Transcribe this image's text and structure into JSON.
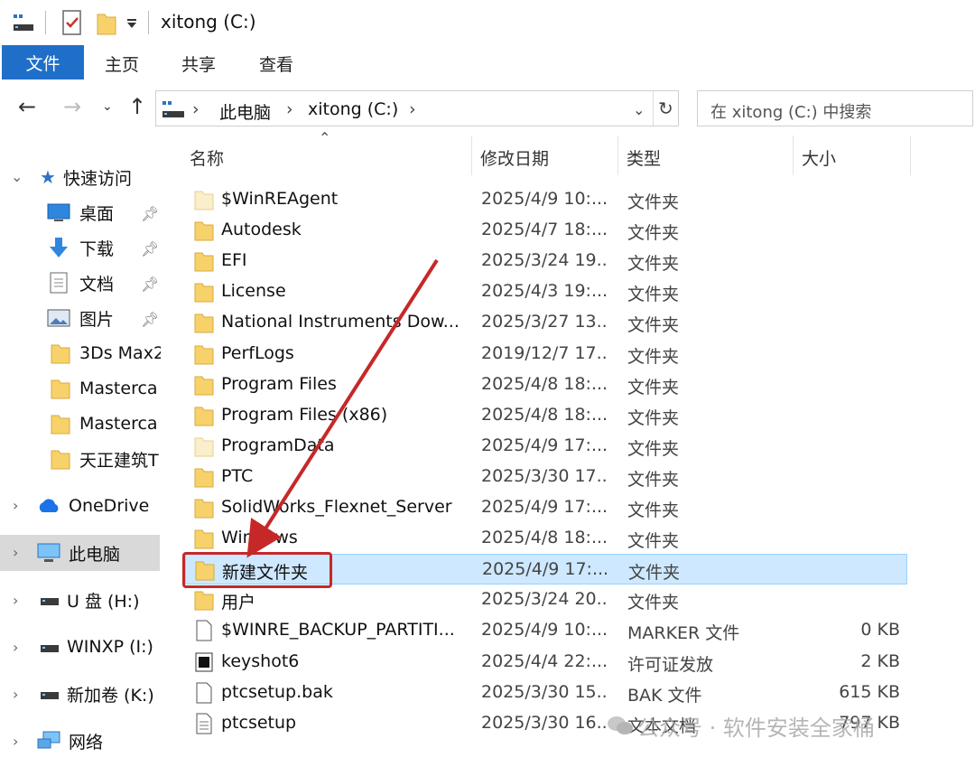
{
  "window": {
    "title": "xitong (C:)"
  },
  "ribbon": {
    "tabs": [
      "文件",
      "主页",
      "共享",
      "查看"
    ]
  },
  "address": {
    "parts": [
      "此电脑",
      "xitong (C:)"
    ]
  },
  "search": {
    "placeholder": "在 xitong (C:) 中搜索"
  },
  "nav": {
    "quick_access": "快速访问",
    "pinned": [
      {
        "label": "桌面",
        "icon": "desktop-icon"
      },
      {
        "label": "下载",
        "icon": "download-icon"
      },
      {
        "label": "文档",
        "icon": "document-icon"
      },
      {
        "label": "图片",
        "icon": "picture-icon"
      }
    ],
    "recent": [
      "3Ds Max2",
      "Masterca",
      "Masterca",
      "天正建筑T"
    ],
    "onedrive": "OneDrive",
    "this_pc": "此电脑",
    "drives": [
      "U 盘 (H:)",
      "WINXP (I:)",
      "新加卷 (K:)"
    ],
    "network": "网络"
  },
  "columns": {
    "name": "名称",
    "date": "修改日期",
    "type": "类型",
    "size": "大小"
  },
  "files": [
    {
      "name": "$WinREAgent",
      "date": "2025/4/9 10:...",
      "type": "文件夹",
      "size": "",
      "icon": "folder-light-icon"
    },
    {
      "name": "Autodesk",
      "date": "2025/4/7 18:...",
      "type": "文件夹",
      "size": "",
      "icon": "folder-icon"
    },
    {
      "name": "EFI",
      "date": "2025/3/24 19...",
      "type": "文件夹",
      "size": "",
      "icon": "folder-icon"
    },
    {
      "name": "License",
      "date": "2025/4/3 19:...",
      "type": "文件夹",
      "size": "",
      "icon": "folder-icon"
    },
    {
      "name": "National Instruments Dow...",
      "date": "2025/3/27 13...",
      "type": "文件夹",
      "size": "",
      "icon": "folder-icon"
    },
    {
      "name": "PerfLogs",
      "date": "2019/12/7 17...",
      "type": "文件夹",
      "size": "",
      "icon": "folder-icon"
    },
    {
      "name": "Program Files",
      "date": "2025/4/8 18:...",
      "type": "文件夹",
      "size": "",
      "icon": "folder-icon"
    },
    {
      "name": "Program Files (x86)",
      "date": "2025/4/8 18:...",
      "type": "文件夹",
      "size": "",
      "icon": "folder-icon"
    },
    {
      "name": "ProgramData",
      "date": "2025/4/9 17:...",
      "type": "文件夹",
      "size": "",
      "icon": "folder-light-icon"
    },
    {
      "name": "PTC",
      "date": "2025/3/30 17...",
      "type": "文件夹",
      "size": "",
      "icon": "folder-icon"
    },
    {
      "name": "SolidWorks_Flexnet_Server",
      "date": "2025/4/9 17:...",
      "type": "文件夹",
      "size": "",
      "icon": "folder-icon"
    },
    {
      "name": "Windows",
      "date": "2025/4/8 18:...",
      "type": "文件夹",
      "size": "",
      "icon": "folder-icon"
    },
    {
      "name": "新建文件夹",
      "date": "2025/4/9 17:...",
      "type": "文件夹",
      "size": "",
      "icon": "folder-icon",
      "selected": true
    },
    {
      "name": "用户",
      "date": "2025/3/24 20...",
      "type": "文件夹",
      "size": "",
      "icon": "folder-icon"
    },
    {
      "name": "$WINRE_BACKUP_PARTITI...",
      "date": "2025/4/9 10:...",
      "type": "MARKER 文件",
      "size": "0 KB",
      "icon": "file-icon"
    },
    {
      "name": "keyshot6",
      "date": "2025/4/4 22:...",
      "type": "许可证发放",
      "size": "2 KB",
      "icon": "license-icon"
    },
    {
      "name": "ptcsetup.bak",
      "date": "2025/3/30 15...",
      "type": "BAK 文件",
      "size": "615 KB",
      "icon": "file-icon"
    },
    {
      "name": "ptcsetup",
      "date": "2025/3/30 16...",
      "type": "文本文档",
      "size": "797 KB",
      "icon": "text-file-icon"
    }
  ],
  "watermark": "公众号 · 软件安装全家桶",
  "colors": {
    "accent": "#1f6fc9",
    "selection": "#cde8ff",
    "annotation": "#c62828",
    "folder": "#f7d26b"
  }
}
